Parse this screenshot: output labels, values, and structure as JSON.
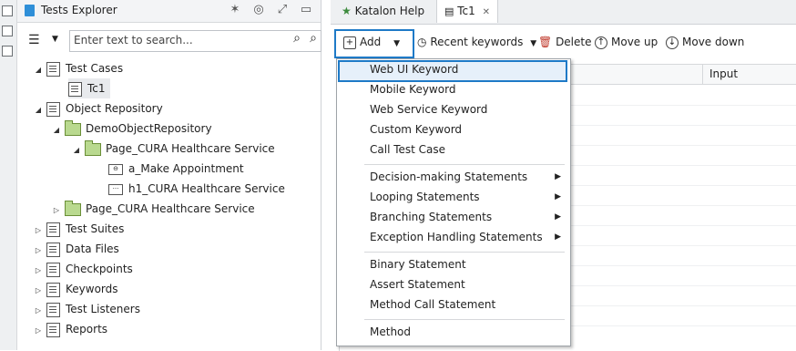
{
  "explorer": {
    "title": "Tests Explorer",
    "search_placeholder": "Enter text to search...",
    "tree": [
      {
        "label": "Test Cases"
      },
      {
        "label": "Tc1"
      },
      {
        "label": "Object Repository"
      },
      {
        "label": "DemoObjectRepository"
      },
      {
        "label": "Page_CURA Healthcare Service"
      },
      {
        "label": "a_Make Appointment"
      },
      {
        "label": "h1_CURA Healthcare Service"
      },
      {
        "label": "Page_CURA Healthcare Service"
      },
      {
        "label": "Test Suites"
      },
      {
        "label": "Data Files"
      },
      {
        "label": "Checkpoints"
      },
      {
        "label": "Keywords"
      },
      {
        "label": "Test Listeners"
      },
      {
        "label": "Reports"
      }
    ]
  },
  "editor": {
    "tabs": [
      "Katalon Help",
      "Tc1"
    ],
    "toolbar": {
      "add": "Add",
      "recent": "Recent keywords",
      "delete": "Delete",
      "move_up": "Move up",
      "move_down": "Move down"
    },
    "grid_header": {
      "input": "Input"
    }
  },
  "menu": {
    "items": [
      "Web UI Keyword",
      "Mobile Keyword",
      "Web Service Keyword",
      "Custom Keyword",
      "Call Test Case",
      "Decision-making Statements",
      "Looping Statements",
      "Branching Statements",
      "Exception Handling Statements",
      "Binary Statement",
      "Assert Statement",
      "Method Call Statement",
      "Method"
    ]
  },
  "colors": {
    "highlight": "#1e7ac7",
    "folder_green": "#b9d98f"
  }
}
